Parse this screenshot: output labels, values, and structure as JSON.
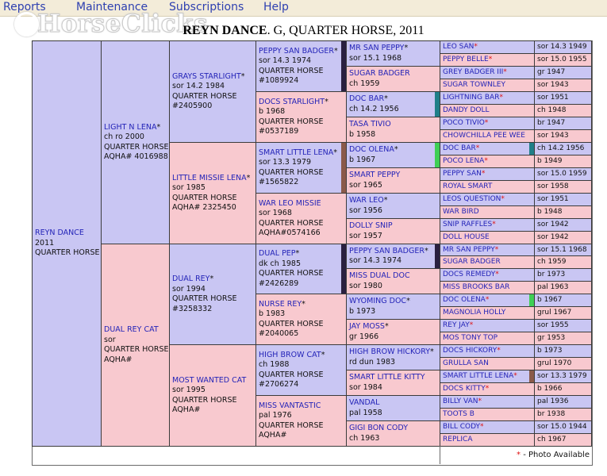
{
  "menu": [
    "Reports",
    "Maintenance",
    "Subscriptions",
    "Help"
  ],
  "logo": "HorseClicks",
  "title": {
    "name": "REYN DANCE",
    "rest": ". G, QUARTER HORSE, 2011"
  },
  "legend": {
    "mark": "*",
    "text": "- Photo Available"
  },
  "colors": {
    "male": "#c9c6f3",
    "female": "#f8c9cf",
    "bar_dark": "#2a2040",
    "bar_teal": "#1f7f88",
    "bar_green": "#3fcf55",
    "bar_brown": "#8a5a4a"
  },
  "subject": {
    "name": "REYN DANCE",
    "l2": "2011",
    "l3": "QUARTER HORSE"
  },
  "g1": [
    {
      "name": "LIGHT N LENA",
      "star": true,
      "l2": "ch ro 2000",
      "l3": "QUARTER HORSE",
      "l4": "AQHA# 4016988"
    },
    {
      "name": "DUAL REY CAT",
      "star": false,
      "l2": "sor",
      "l3": "QUARTER HORSE",
      "l4": "AQHA#"
    }
  ],
  "g2": [
    {
      "name": "GRAYS STARLIGHT",
      "star": true,
      "l2": "sor 14.2 1984",
      "l3": "QUARTER HORSE",
      "l4": "#2405900"
    },
    {
      "name": "LITTLE MISSIE LENA",
      "star": true,
      "l2": "sor 1985",
      "l3": "QUARTER HORSE",
      "l4": "AQHA# 2325450"
    },
    {
      "name": "DUAL REY",
      "star": true,
      "l2": "sor 1994",
      "l3": "QUARTER HORSE",
      "l4": "#3258332"
    },
    {
      "name": "MOST WANTED CAT",
      "star": false,
      "l2": "sor 1995",
      "l3": "QUARTER HORSE",
      "l4": "AQHA#"
    }
  ],
  "g3": [
    {
      "name": "PEPPY SAN BADGER",
      "star": true,
      "l2": "sor 14.3 1974",
      "l3": "QUARTER HORSE",
      "l4": "#1089924"
    },
    {
      "name": "DOCS STARLIGHT",
      "star": true,
      "l2": "b 1968",
      "l3": "QUARTER HORSE",
      "l4": "#0537189"
    },
    {
      "name": "SMART LITTLE LENA",
      "star": true,
      "l2": "sor 13.3 1979",
      "l3": "QUARTER HORSE",
      "l4": "#1565822"
    },
    {
      "name": "WAR LEO MISSIE",
      "star": false,
      "l2": "sor 1968",
      "l3": "QUARTER HORSE",
      "l4": "AQHA#0574166"
    },
    {
      "name": "DUAL PEP",
      "star": true,
      "l2": "dk ch 1985",
      "l3": "QUARTER HORSE",
      "l4": "#2426289"
    },
    {
      "name": "NURSE REY",
      "star": true,
      "l2": "b 1983",
      "l3": "QUARTER HORSE",
      "l4": "#2040065"
    },
    {
      "name": "HIGH BROW CAT",
      "star": true,
      "l2": "ch 1988",
      "l3": "QUARTER HORSE",
      "l4": "#2706274"
    },
    {
      "name": "MISS VANTASTIC",
      "star": false,
      "l2": "pal 1976",
      "l3": "QUARTER HORSE",
      "l4": "AQHA#"
    }
  ],
  "g4": [
    {
      "name": "MR SAN PEPPY",
      "star": true,
      "l2": "sor 15.1 1968"
    },
    {
      "name": "SUGAR BADGER",
      "star": false,
      "l2": "ch 1959"
    },
    {
      "name": "DOC BAR",
      "star": true,
      "l2": "ch 14.2 1956"
    },
    {
      "name": "TASA TIVIO",
      "star": false,
      "l2": "b 1958"
    },
    {
      "name": "DOC OLENA",
      "star": true,
      "l2": "b 1967"
    },
    {
      "name": "SMART PEPPY",
      "star": false,
      "l2": "sor 1965"
    },
    {
      "name": "WAR LEO",
      "star": true,
      "l2": "sor 1956"
    },
    {
      "name": "DOLLY SNIP",
      "star": false,
      "l2": "sor 1957"
    },
    {
      "name": "PEPPY SAN BADGER",
      "star": true,
      "l2": "sor 14.3 1974"
    },
    {
      "name": "MISS DUAL DOC",
      "star": false,
      "l2": "sor 1980"
    },
    {
      "name": "WYOMING DOC",
      "star": true,
      "l2": "b 1973"
    },
    {
      "name": "JAY MOSS",
      "star": true,
      "l2": "gr 1966"
    },
    {
      "name": "HIGH BROW HICKORY",
      "star": true,
      "l2": "rd dun 1983"
    },
    {
      "name": "SMART LITTLE KITTY",
      "star": false,
      "l2": "sor 1984"
    },
    {
      "name": "VANDAL",
      "star": false,
      "l2": "pal 1958"
    },
    {
      "name": "GIGI BON CODY",
      "star": false,
      "l2": "ch 1963"
    }
  ],
  "g5": [
    {
      "name": "LEO SAN",
      "star": true,
      "info": "sor 14.3 1949"
    },
    {
      "name": "PEPPY BELLE",
      "star": true,
      "info": "sor 15.0 1955"
    },
    {
      "name": "GREY BADGER III",
      "star": true,
      "info": "gr 1947"
    },
    {
      "name": "SUGAR TOWNLEY",
      "star": false,
      "info": "sor 1943"
    },
    {
      "name": "LIGHTNING BAR",
      "star": true,
      "info": "sor 1951"
    },
    {
      "name": "DANDY DOLL",
      "star": false,
      "info": "ch 1948"
    },
    {
      "name": "POCO TIVIO",
      "star": true,
      "info": "br 1947"
    },
    {
      "name": "CHOWCHILLA PEE WEE",
      "star": false,
      "info": "sor 1943"
    },
    {
      "name": "DOC BAR",
      "star": true,
      "info": "ch 14.2 1956"
    },
    {
      "name": "POCO LENA",
      "star": true,
      "info": "b 1949"
    },
    {
      "name": "PEPPY SAN",
      "star": true,
      "info": "sor 15.0 1959"
    },
    {
      "name": "ROYAL SMART",
      "star": false,
      "info": "sor 1958"
    },
    {
      "name": "LEOS QUESTION",
      "star": true,
      "info": "sor 1951"
    },
    {
      "name": "WAR BIRD",
      "star": false,
      "info": "b 1948"
    },
    {
      "name": "SNIP RAFFLES",
      "star": true,
      "info": "sor 1942"
    },
    {
      "name": "DOLL HOUSE",
      "star": false,
      "info": "sor 1942"
    },
    {
      "name": "MR SAN PEPPY",
      "star": true,
      "info": "sor 15.1 1968"
    },
    {
      "name": "SUGAR BADGER",
      "star": false,
      "info": "ch 1959"
    },
    {
      "name": "DOCS REMEDY",
      "star": true,
      "info": "br 1973"
    },
    {
      "name": "MISS BROOKS BAR",
      "star": false,
      "info": "pal 1963"
    },
    {
      "name": "DOC OLENA",
      "star": true,
      "info": "b 1967"
    },
    {
      "name": "MAGNOLIA HOLLY",
      "star": false,
      "info": "grul 1967"
    },
    {
      "name": "REY JAY",
      "star": true,
      "info": "sor 1955"
    },
    {
      "name": "MOS TONY TOP",
      "star": false,
      "info": "gr 1953"
    },
    {
      "name": "DOCS HICKORY",
      "star": true,
      "info": "b 1973"
    },
    {
      "name": "GRULLA SAN",
      "star": false,
      "info": "grul 1970"
    },
    {
      "name": "SMART LITTLE LENA",
      "star": true,
      "info": "sor 13.3 1979"
    },
    {
      "name": "DOCS KITTY",
      "star": true,
      "info": "b 1966"
    },
    {
      "name": "BILLY VAN",
      "star": true,
      "info": "pal 1936"
    },
    {
      "name": "TOOTS B",
      "star": false,
      "info": "br 1938"
    },
    {
      "name": "BILL CODY",
      "star": true,
      "info": "sor 15.0 1944"
    },
    {
      "name": "REPLICA",
      "star": false,
      "info": "ch 1967"
    }
  ]
}
